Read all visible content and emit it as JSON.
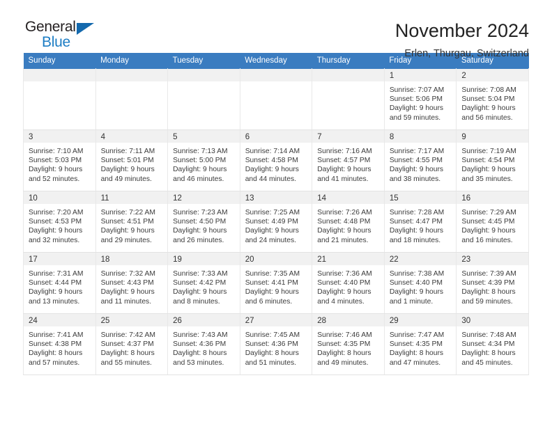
{
  "brand": {
    "name_part1": "General",
    "name_part2": "Blue",
    "triangle_color": "#1469ad",
    "blue_text_color": "#1d7dc4"
  },
  "header": {
    "title": "November 2024",
    "subtitle": "Erlen, Thurgau, Switzerland",
    "accent_color": "#3a7cc0"
  },
  "weekday_headers": [
    "Sunday",
    "Monday",
    "Tuesday",
    "Wednesday",
    "Thursday",
    "Friday",
    "Saturday"
  ],
  "weeks": [
    [
      {
        "date": "",
        "sunrise": "",
        "sunset": "",
        "daylight_line1": "",
        "daylight_line2": "",
        "empty": true
      },
      {
        "date": "",
        "sunrise": "",
        "sunset": "",
        "daylight_line1": "",
        "daylight_line2": "",
        "empty": true
      },
      {
        "date": "",
        "sunrise": "",
        "sunset": "",
        "daylight_line1": "",
        "daylight_line2": "",
        "empty": true
      },
      {
        "date": "",
        "sunrise": "",
        "sunset": "",
        "daylight_line1": "",
        "daylight_line2": "",
        "empty": true
      },
      {
        "date": "",
        "sunrise": "",
        "sunset": "",
        "daylight_line1": "",
        "daylight_line2": "",
        "empty": true
      },
      {
        "date": "1",
        "sunrise": "Sunrise: 7:07 AM",
        "sunset": "Sunset: 5:06 PM",
        "daylight_line1": "Daylight: 9 hours",
        "daylight_line2": "and 59 minutes."
      },
      {
        "date": "2",
        "sunrise": "Sunrise: 7:08 AM",
        "sunset": "Sunset: 5:04 PM",
        "daylight_line1": "Daylight: 9 hours",
        "daylight_line2": "and 56 minutes."
      }
    ],
    [
      {
        "date": "3",
        "sunrise": "Sunrise: 7:10 AM",
        "sunset": "Sunset: 5:03 PM",
        "daylight_line1": "Daylight: 9 hours",
        "daylight_line2": "and 52 minutes."
      },
      {
        "date": "4",
        "sunrise": "Sunrise: 7:11 AM",
        "sunset": "Sunset: 5:01 PM",
        "daylight_line1": "Daylight: 9 hours",
        "daylight_line2": "and 49 minutes."
      },
      {
        "date": "5",
        "sunrise": "Sunrise: 7:13 AM",
        "sunset": "Sunset: 5:00 PM",
        "daylight_line1": "Daylight: 9 hours",
        "daylight_line2": "and 46 minutes."
      },
      {
        "date": "6",
        "sunrise": "Sunrise: 7:14 AM",
        "sunset": "Sunset: 4:58 PM",
        "daylight_line1": "Daylight: 9 hours",
        "daylight_line2": "and 44 minutes."
      },
      {
        "date": "7",
        "sunrise": "Sunrise: 7:16 AM",
        "sunset": "Sunset: 4:57 PM",
        "daylight_line1": "Daylight: 9 hours",
        "daylight_line2": "and 41 minutes."
      },
      {
        "date": "8",
        "sunrise": "Sunrise: 7:17 AM",
        "sunset": "Sunset: 4:55 PM",
        "daylight_line1": "Daylight: 9 hours",
        "daylight_line2": "and 38 minutes."
      },
      {
        "date": "9",
        "sunrise": "Sunrise: 7:19 AM",
        "sunset": "Sunset: 4:54 PM",
        "daylight_line1": "Daylight: 9 hours",
        "daylight_line2": "and 35 minutes."
      }
    ],
    [
      {
        "date": "10",
        "sunrise": "Sunrise: 7:20 AM",
        "sunset": "Sunset: 4:53 PM",
        "daylight_line1": "Daylight: 9 hours",
        "daylight_line2": "and 32 minutes."
      },
      {
        "date": "11",
        "sunrise": "Sunrise: 7:22 AM",
        "sunset": "Sunset: 4:51 PM",
        "daylight_line1": "Daylight: 9 hours",
        "daylight_line2": "and 29 minutes."
      },
      {
        "date": "12",
        "sunrise": "Sunrise: 7:23 AM",
        "sunset": "Sunset: 4:50 PM",
        "daylight_line1": "Daylight: 9 hours",
        "daylight_line2": "and 26 minutes."
      },
      {
        "date": "13",
        "sunrise": "Sunrise: 7:25 AM",
        "sunset": "Sunset: 4:49 PM",
        "daylight_line1": "Daylight: 9 hours",
        "daylight_line2": "and 24 minutes."
      },
      {
        "date": "14",
        "sunrise": "Sunrise: 7:26 AM",
        "sunset": "Sunset: 4:48 PM",
        "daylight_line1": "Daylight: 9 hours",
        "daylight_line2": "and 21 minutes."
      },
      {
        "date": "15",
        "sunrise": "Sunrise: 7:28 AM",
        "sunset": "Sunset: 4:47 PM",
        "daylight_line1": "Daylight: 9 hours",
        "daylight_line2": "and 18 minutes."
      },
      {
        "date": "16",
        "sunrise": "Sunrise: 7:29 AM",
        "sunset": "Sunset: 4:45 PM",
        "daylight_line1": "Daylight: 9 hours",
        "daylight_line2": "and 16 minutes."
      }
    ],
    [
      {
        "date": "17",
        "sunrise": "Sunrise: 7:31 AM",
        "sunset": "Sunset: 4:44 PM",
        "daylight_line1": "Daylight: 9 hours",
        "daylight_line2": "and 13 minutes."
      },
      {
        "date": "18",
        "sunrise": "Sunrise: 7:32 AM",
        "sunset": "Sunset: 4:43 PM",
        "daylight_line1": "Daylight: 9 hours",
        "daylight_line2": "and 11 minutes."
      },
      {
        "date": "19",
        "sunrise": "Sunrise: 7:33 AM",
        "sunset": "Sunset: 4:42 PM",
        "daylight_line1": "Daylight: 9 hours",
        "daylight_line2": "and 8 minutes."
      },
      {
        "date": "20",
        "sunrise": "Sunrise: 7:35 AM",
        "sunset": "Sunset: 4:41 PM",
        "daylight_line1": "Daylight: 9 hours",
        "daylight_line2": "and 6 minutes."
      },
      {
        "date": "21",
        "sunrise": "Sunrise: 7:36 AM",
        "sunset": "Sunset: 4:40 PM",
        "daylight_line1": "Daylight: 9 hours",
        "daylight_line2": "and 4 minutes."
      },
      {
        "date": "22",
        "sunrise": "Sunrise: 7:38 AM",
        "sunset": "Sunset: 4:40 PM",
        "daylight_line1": "Daylight: 9 hours",
        "daylight_line2": "and 1 minute."
      },
      {
        "date": "23",
        "sunrise": "Sunrise: 7:39 AM",
        "sunset": "Sunset: 4:39 PM",
        "daylight_line1": "Daylight: 8 hours",
        "daylight_line2": "and 59 minutes."
      }
    ],
    [
      {
        "date": "24",
        "sunrise": "Sunrise: 7:41 AM",
        "sunset": "Sunset: 4:38 PM",
        "daylight_line1": "Daylight: 8 hours",
        "daylight_line2": "and 57 minutes."
      },
      {
        "date": "25",
        "sunrise": "Sunrise: 7:42 AM",
        "sunset": "Sunset: 4:37 PM",
        "daylight_line1": "Daylight: 8 hours",
        "daylight_line2": "and 55 minutes."
      },
      {
        "date": "26",
        "sunrise": "Sunrise: 7:43 AM",
        "sunset": "Sunset: 4:36 PM",
        "daylight_line1": "Daylight: 8 hours",
        "daylight_line2": "and 53 minutes."
      },
      {
        "date": "27",
        "sunrise": "Sunrise: 7:45 AM",
        "sunset": "Sunset: 4:36 PM",
        "daylight_line1": "Daylight: 8 hours",
        "daylight_line2": "and 51 minutes."
      },
      {
        "date": "28",
        "sunrise": "Sunrise: 7:46 AM",
        "sunset": "Sunset: 4:35 PM",
        "daylight_line1": "Daylight: 8 hours",
        "daylight_line2": "and 49 minutes."
      },
      {
        "date": "29",
        "sunrise": "Sunrise: 7:47 AM",
        "sunset": "Sunset: 4:35 PM",
        "daylight_line1": "Daylight: 8 hours",
        "daylight_line2": "and 47 minutes."
      },
      {
        "date": "30",
        "sunrise": "Sunrise: 7:48 AM",
        "sunset": "Sunset: 4:34 PM",
        "daylight_line1": "Daylight: 8 hours",
        "daylight_line2": "and 45 minutes."
      }
    ]
  ]
}
